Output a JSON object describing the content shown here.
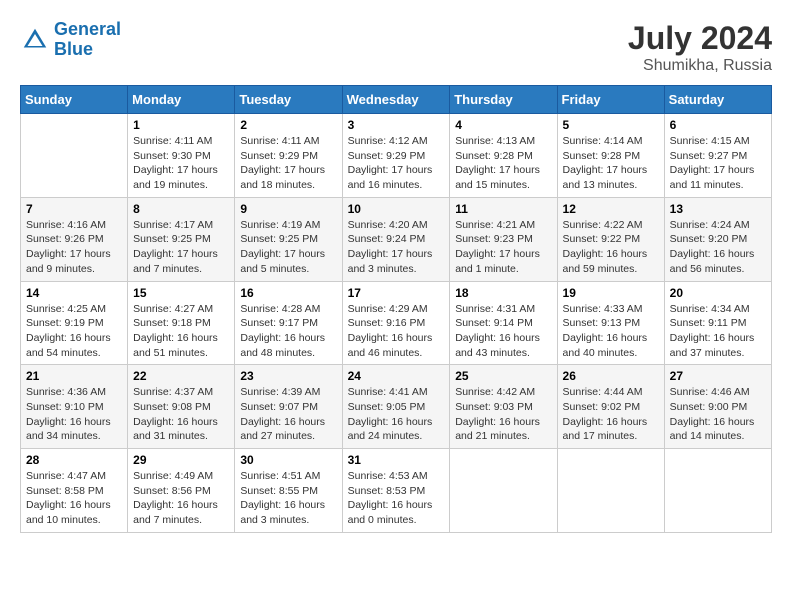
{
  "header": {
    "logo_line1": "General",
    "logo_line2": "Blue",
    "month_year": "July 2024",
    "location": "Shumikha, Russia"
  },
  "weekdays": [
    "Sunday",
    "Monday",
    "Tuesday",
    "Wednesday",
    "Thursday",
    "Friday",
    "Saturday"
  ],
  "weeks": [
    [
      {
        "day": "",
        "sunrise": "",
        "sunset": "",
        "daylight": ""
      },
      {
        "day": "1",
        "sunrise": "Sunrise: 4:11 AM",
        "sunset": "Sunset: 9:30 PM",
        "daylight": "Daylight: 17 hours and 19 minutes."
      },
      {
        "day": "2",
        "sunrise": "Sunrise: 4:11 AM",
        "sunset": "Sunset: 9:29 PM",
        "daylight": "Daylight: 17 hours and 18 minutes."
      },
      {
        "day": "3",
        "sunrise": "Sunrise: 4:12 AM",
        "sunset": "Sunset: 9:29 PM",
        "daylight": "Daylight: 17 hours and 16 minutes."
      },
      {
        "day": "4",
        "sunrise": "Sunrise: 4:13 AM",
        "sunset": "Sunset: 9:28 PM",
        "daylight": "Daylight: 17 hours and 15 minutes."
      },
      {
        "day": "5",
        "sunrise": "Sunrise: 4:14 AM",
        "sunset": "Sunset: 9:28 PM",
        "daylight": "Daylight: 17 hours and 13 minutes."
      },
      {
        "day": "6",
        "sunrise": "Sunrise: 4:15 AM",
        "sunset": "Sunset: 9:27 PM",
        "daylight": "Daylight: 17 hours and 11 minutes."
      }
    ],
    [
      {
        "day": "7",
        "sunrise": "Sunrise: 4:16 AM",
        "sunset": "Sunset: 9:26 PM",
        "daylight": "Daylight: 17 hours and 9 minutes."
      },
      {
        "day": "8",
        "sunrise": "Sunrise: 4:17 AM",
        "sunset": "Sunset: 9:25 PM",
        "daylight": "Daylight: 17 hours and 7 minutes."
      },
      {
        "day": "9",
        "sunrise": "Sunrise: 4:19 AM",
        "sunset": "Sunset: 9:25 PM",
        "daylight": "Daylight: 17 hours and 5 minutes."
      },
      {
        "day": "10",
        "sunrise": "Sunrise: 4:20 AM",
        "sunset": "Sunset: 9:24 PM",
        "daylight": "Daylight: 17 hours and 3 minutes."
      },
      {
        "day": "11",
        "sunrise": "Sunrise: 4:21 AM",
        "sunset": "Sunset: 9:23 PM",
        "daylight": "Daylight: 17 hours and 1 minute."
      },
      {
        "day": "12",
        "sunrise": "Sunrise: 4:22 AM",
        "sunset": "Sunset: 9:22 PM",
        "daylight": "Daylight: 16 hours and 59 minutes."
      },
      {
        "day": "13",
        "sunrise": "Sunrise: 4:24 AM",
        "sunset": "Sunset: 9:20 PM",
        "daylight": "Daylight: 16 hours and 56 minutes."
      }
    ],
    [
      {
        "day": "14",
        "sunrise": "Sunrise: 4:25 AM",
        "sunset": "Sunset: 9:19 PM",
        "daylight": "Daylight: 16 hours and 54 minutes."
      },
      {
        "day": "15",
        "sunrise": "Sunrise: 4:27 AM",
        "sunset": "Sunset: 9:18 PM",
        "daylight": "Daylight: 16 hours and 51 minutes."
      },
      {
        "day": "16",
        "sunrise": "Sunrise: 4:28 AM",
        "sunset": "Sunset: 9:17 PM",
        "daylight": "Daylight: 16 hours and 48 minutes."
      },
      {
        "day": "17",
        "sunrise": "Sunrise: 4:29 AM",
        "sunset": "Sunset: 9:16 PM",
        "daylight": "Daylight: 16 hours and 46 minutes."
      },
      {
        "day": "18",
        "sunrise": "Sunrise: 4:31 AM",
        "sunset": "Sunset: 9:14 PM",
        "daylight": "Daylight: 16 hours and 43 minutes."
      },
      {
        "day": "19",
        "sunrise": "Sunrise: 4:33 AM",
        "sunset": "Sunset: 9:13 PM",
        "daylight": "Daylight: 16 hours and 40 minutes."
      },
      {
        "day": "20",
        "sunrise": "Sunrise: 4:34 AM",
        "sunset": "Sunset: 9:11 PM",
        "daylight": "Daylight: 16 hours and 37 minutes."
      }
    ],
    [
      {
        "day": "21",
        "sunrise": "Sunrise: 4:36 AM",
        "sunset": "Sunset: 9:10 PM",
        "daylight": "Daylight: 16 hours and 34 minutes."
      },
      {
        "day": "22",
        "sunrise": "Sunrise: 4:37 AM",
        "sunset": "Sunset: 9:08 PM",
        "daylight": "Daylight: 16 hours and 31 minutes."
      },
      {
        "day": "23",
        "sunrise": "Sunrise: 4:39 AM",
        "sunset": "Sunset: 9:07 PM",
        "daylight": "Daylight: 16 hours and 27 minutes."
      },
      {
        "day": "24",
        "sunrise": "Sunrise: 4:41 AM",
        "sunset": "Sunset: 9:05 PM",
        "daylight": "Daylight: 16 hours and 24 minutes."
      },
      {
        "day": "25",
        "sunrise": "Sunrise: 4:42 AM",
        "sunset": "Sunset: 9:03 PM",
        "daylight": "Daylight: 16 hours and 21 minutes."
      },
      {
        "day": "26",
        "sunrise": "Sunrise: 4:44 AM",
        "sunset": "Sunset: 9:02 PM",
        "daylight": "Daylight: 16 hours and 17 minutes."
      },
      {
        "day": "27",
        "sunrise": "Sunrise: 4:46 AM",
        "sunset": "Sunset: 9:00 PM",
        "daylight": "Daylight: 16 hours and 14 minutes."
      }
    ],
    [
      {
        "day": "28",
        "sunrise": "Sunrise: 4:47 AM",
        "sunset": "Sunset: 8:58 PM",
        "daylight": "Daylight: 16 hours and 10 minutes."
      },
      {
        "day": "29",
        "sunrise": "Sunrise: 4:49 AM",
        "sunset": "Sunset: 8:56 PM",
        "daylight": "Daylight: 16 hours and 7 minutes."
      },
      {
        "day": "30",
        "sunrise": "Sunrise: 4:51 AM",
        "sunset": "Sunset: 8:55 PM",
        "daylight": "Daylight: 16 hours and 3 minutes."
      },
      {
        "day": "31",
        "sunrise": "Sunrise: 4:53 AM",
        "sunset": "Sunset: 8:53 PM",
        "daylight": "Daylight: 16 hours and 0 minutes."
      },
      {
        "day": "",
        "sunrise": "",
        "sunset": "",
        "daylight": ""
      },
      {
        "day": "",
        "sunrise": "",
        "sunset": "",
        "daylight": ""
      },
      {
        "day": "",
        "sunrise": "",
        "sunset": "",
        "daylight": ""
      }
    ]
  ]
}
